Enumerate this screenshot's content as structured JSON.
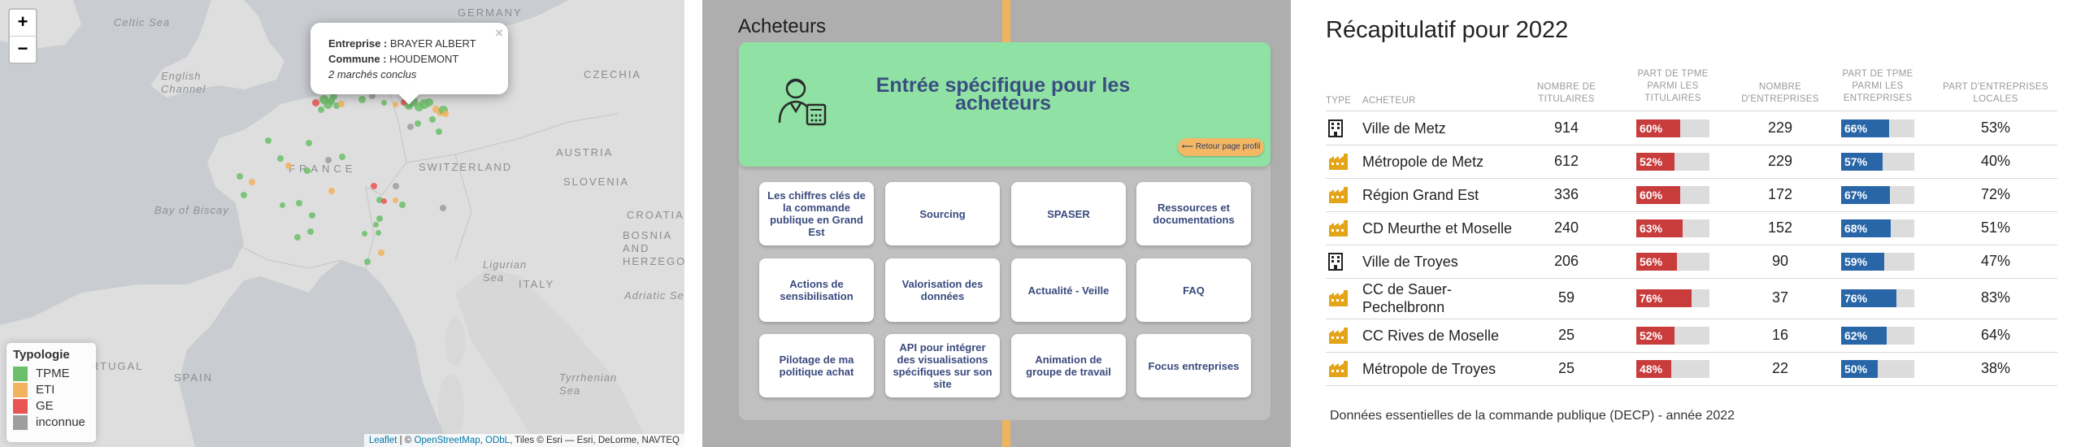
{
  "map": {
    "zoom_in": "+",
    "zoom_out": "−",
    "labels": {
      "celtic_sea": "Celtic Sea",
      "english_channel": "English\nChannel",
      "germany": "GERMANY",
      "czechia": "CZECHIA",
      "austria": "AUSTRIA",
      "france": "FRANCE",
      "switzerland": "SWITZERLAND",
      "slovenia": "SLOVENIA",
      "croatia": "CROATIA",
      "bay_of_biscay": "Bay of Biscay",
      "bosnia": "BOSNIA\nAND\nHERZEGOVI",
      "ligurian_sea": "Ligurian\nSea",
      "italy": "ITALY",
      "adriatic_sea": "Adriatic Sea",
      "portugal": "RTUGAL",
      "spain": "SPAIN",
      "tyrrhenian_sea": "Tyrrhenian\nSea"
    },
    "popup": {
      "line1_label": "Entreprise :",
      "line1_value": "BRAYER ALBERT",
      "line2_label": "Commune :",
      "line2_value": "HOUDEMONT",
      "line3": "2 marchés conclus",
      "close": "×"
    },
    "legend": {
      "title": "Typologie",
      "items": [
        {
          "label": "TPME",
          "color": "#6cbf6a"
        },
        {
          "label": "ETI",
          "color": "#f2b35e"
        },
        {
          "label": "GE",
          "color": "#e95454"
        },
        {
          "label": "inconnue",
          "color": "#9e9e9e"
        }
      ]
    },
    "attribution": {
      "leaflet": "Leaflet",
      "sep1": " | © ",
      "osm": "OpenStreetMap",
      "sep2": ", ",
      "odbl": "ODbL",
      "rest": ", Tiles © Esri — Esri, DeLorme, NAVTEQ"
    }
  },
  "middle": {
    "title": "Acheteurs",
    "hero_title": "Entrée spécifique pour les acheteurs",
    "back_button": "Retour page profil",
    "tiles": [
      "Les chiffres clés de la commande publique en Grand Est",
      "Sourcing",
      "SPASER",
      "Ressources et documentations",
      "Actions de sensibilisation",
      "Valorisation des données",
      "Actualité - Veille",
      "FAQ",
      "Pilotage de ma politique achat",
      "API pour intégrer des visualisations spécifiques sur son site",
      "Animation de groupe de travail",
      "Focus entreprises"
    ]
  },
  "recap": {
    "title": "Récapitulatif pour 2022",
    "headers": {
      "type": "TYPE",
      "acheteur": "ACHETEUR",
      "titulaires": "NOMBRE DE\nTITULAIRES",
      "part_titulaires": "PART DE TPME\nPARMI LES\nTITULAIRES",
      "entreprises": "NOMBRE\nD'ENTREPRISES",
      "part_entreprises": "PART DE TPME\nPARMI LES\nENTREPRISES",
      "locales": "PART D'ENTREPRISES\nLOCALES"
    },
    "colors": {
      "red_bar": "#c83c3c",
      "blue_bar": "#2866a8",
      "icon_gold": "#e3a517"
    },
    "rows": [
      {
        "icon": "building-icon",
        "acheteur": "Ville de Metz",
        "titulaires": "914",
        "part_titulaires": "60%",
        "part_titulaires_frac": 0.6,
        "entreprises": "229",
        "part_entreprises": "66%",
        "part_entreprises_frac": 0.66,
        "locales": "53%"
      },
      {
        "icon": "factory-icon",
        "acheteur": "Métropole de Metz",
        "titulaires": "612",
        "part_titulaires": "52%",
        "part_titulaires_frac": 0.52,
        "entreprises": "229",
        "part_entreprises": "57%",
        "part_entreprises_frac": 0.57,
        "locales": "40%"
      },
      {
        "icon": "factory-icon",
        "acheteur": "Région Grand Est",
        "titulaires": "336",
        "part_titulaires": "60%",
        "part_titulaires_frac": 0.6,
        "entreprises": "172",
        "part_entreprises": "67%",
        "part_entreprises_frac": 0.67,
        "locales": "72%"
      },
      {
        "icon": "factory-icon",
        "acheteur": "CD Meurthe et Moselle",
        "titulaires": "240",
        "part_titulaires": "63%",
        "part_titulaires_frac": 0.63,
        "entreprises": "152",
        "part_entreprises": "68%",
        "part_entreprises_frac": 0.68,
        "locales": "51%"
      },
      {
        "icon": "building-icon",
        "acheteur": "Ville de Troyes",
        "titulaires": "206",
        "part_titulaires": "56%",
        "part_titulaires_frac": 0.56,
        "entreprises": "90",
        "part_entreprises": "59%",
        "part_entreprises_frac": 0.59,
        "locales": "47%"
      },
      {
        "icon": "factory-icon",
        "acheteur": "CC de Sauer-\nPechelbronn",
        "titulaires": "59",
        "part_titulaires": "76%",
        "part_titulaires_frac": 0.76,
        "entreprises": "37",
        "part_entreprises": "76%",
        "part_entreprises_frac": 0.76,
        "locales": "83%"
      },
      {
        "icon": "factory-icon",
        "acheteur": "CC Rives de Moselle",
        "titulaires": "25",
        "part_titulaires": "52%",
        "part_titulaires_frac": 0.52,
        "entreprises": "16",
        "part_entreprises": "62%",
        "part_entreprises_frac": 0.62,
        "locales": "64%"
      },
      {
        "icon": "factory-icon",
        "acheteur": "Métropole de Troyes",
        "titulaires": "25",
        "part_titulaires": "48%",
        "part_titulaires_frac": 0.48,
        "entreprises": "22",
        "part_entreprises": "50%",
        "part_entreprises_frac": 0.5,
        "locales": "38%"
      }
    ],
    "footer": "Données essentielles de la commande publique (DECP) - année 2022"
  }
}
